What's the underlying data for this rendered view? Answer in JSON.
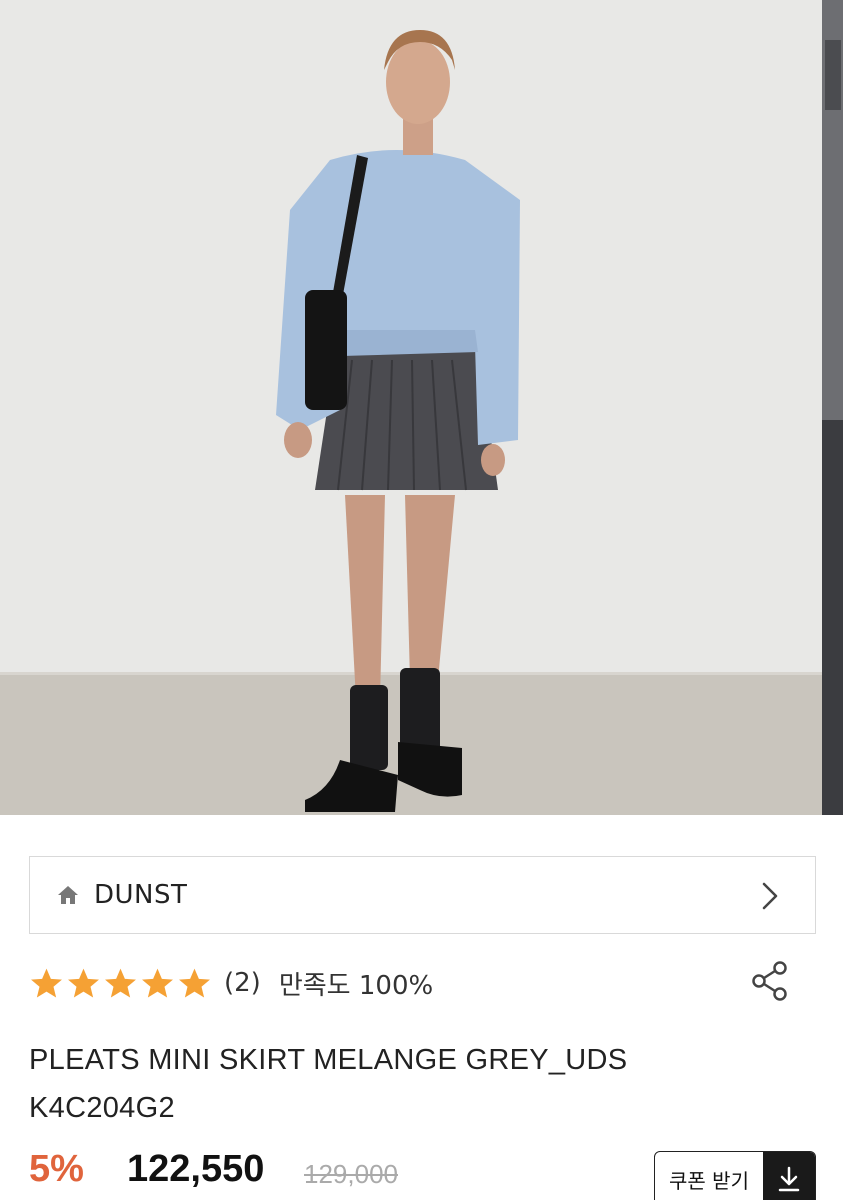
{
  "brand": {
    "name": "DUNST"
  },
  "rating": {
    "stars": 5,
    "max_stars": 5,
    "review_count": "(2)",
    "satisfaction": "만족도 100%"
  },
  "product": {
    "title_line1": "PLEATS MINI SKIRT MELANGE GREY_UDS",
    "title_line2": "K4C204G2",
    "discount": "5%",
    "price": "122,550",
    "original_price": "129,000"
  },
  "coupon": {
    "label": "쿠폰 받기"
  },
  "icons": {
    "home": "home-icon",
    "chevron": "chevron-right-icon",
    "star": "star-icon",
    "share": "share-icon",
    "download": "download-icon"
  },
  "colors": {
    "accent": "#e0643c",
    "star": "#f5a134",
    "border": "#d9d9d9"
  }
}
